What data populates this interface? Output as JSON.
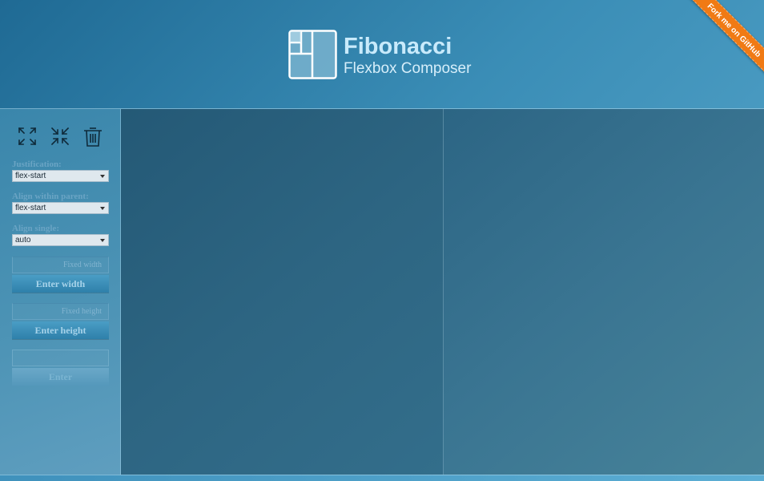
{
  "header": {
    "title": "Fibonacci",
    "subtitle": "Flexbox Composer",
    "logo_icon": "fibonacci-logo-icon",
    "ribbon_label": "Fork me on GitHub"
  },
  "toolbar": {
    "icons": [
      "expand-icon",
      "collapse-icon",
      "trash-icon"
    ]
  },
  "controls": {
    "justification": {
      "label": "Justification:",
      "selected": "flex-start"
    },
    "align_within_parent": {
      "label": "Align within parent:",
      "selected": "flex-start"
    },
    "align_single": {
      "label": "Align single:",
      "selected": "auto"
    },
    "width": {
      "placeholder": "Fixed width",
      "button_label": "Enter width"
    },
    "height": {
      "placeholder": "Fixed height",
      "button_label": "Enter height"
    },
    "generic": {
      "placeholder": "",
      "button_label": "Enter"
    }
  },
  "colors": {
    "ribbon": "#f07a14",
    "title": "#c8eafb",
    "pane_dark": "#245976",
    "pane_light": "#478399"
  }
}
